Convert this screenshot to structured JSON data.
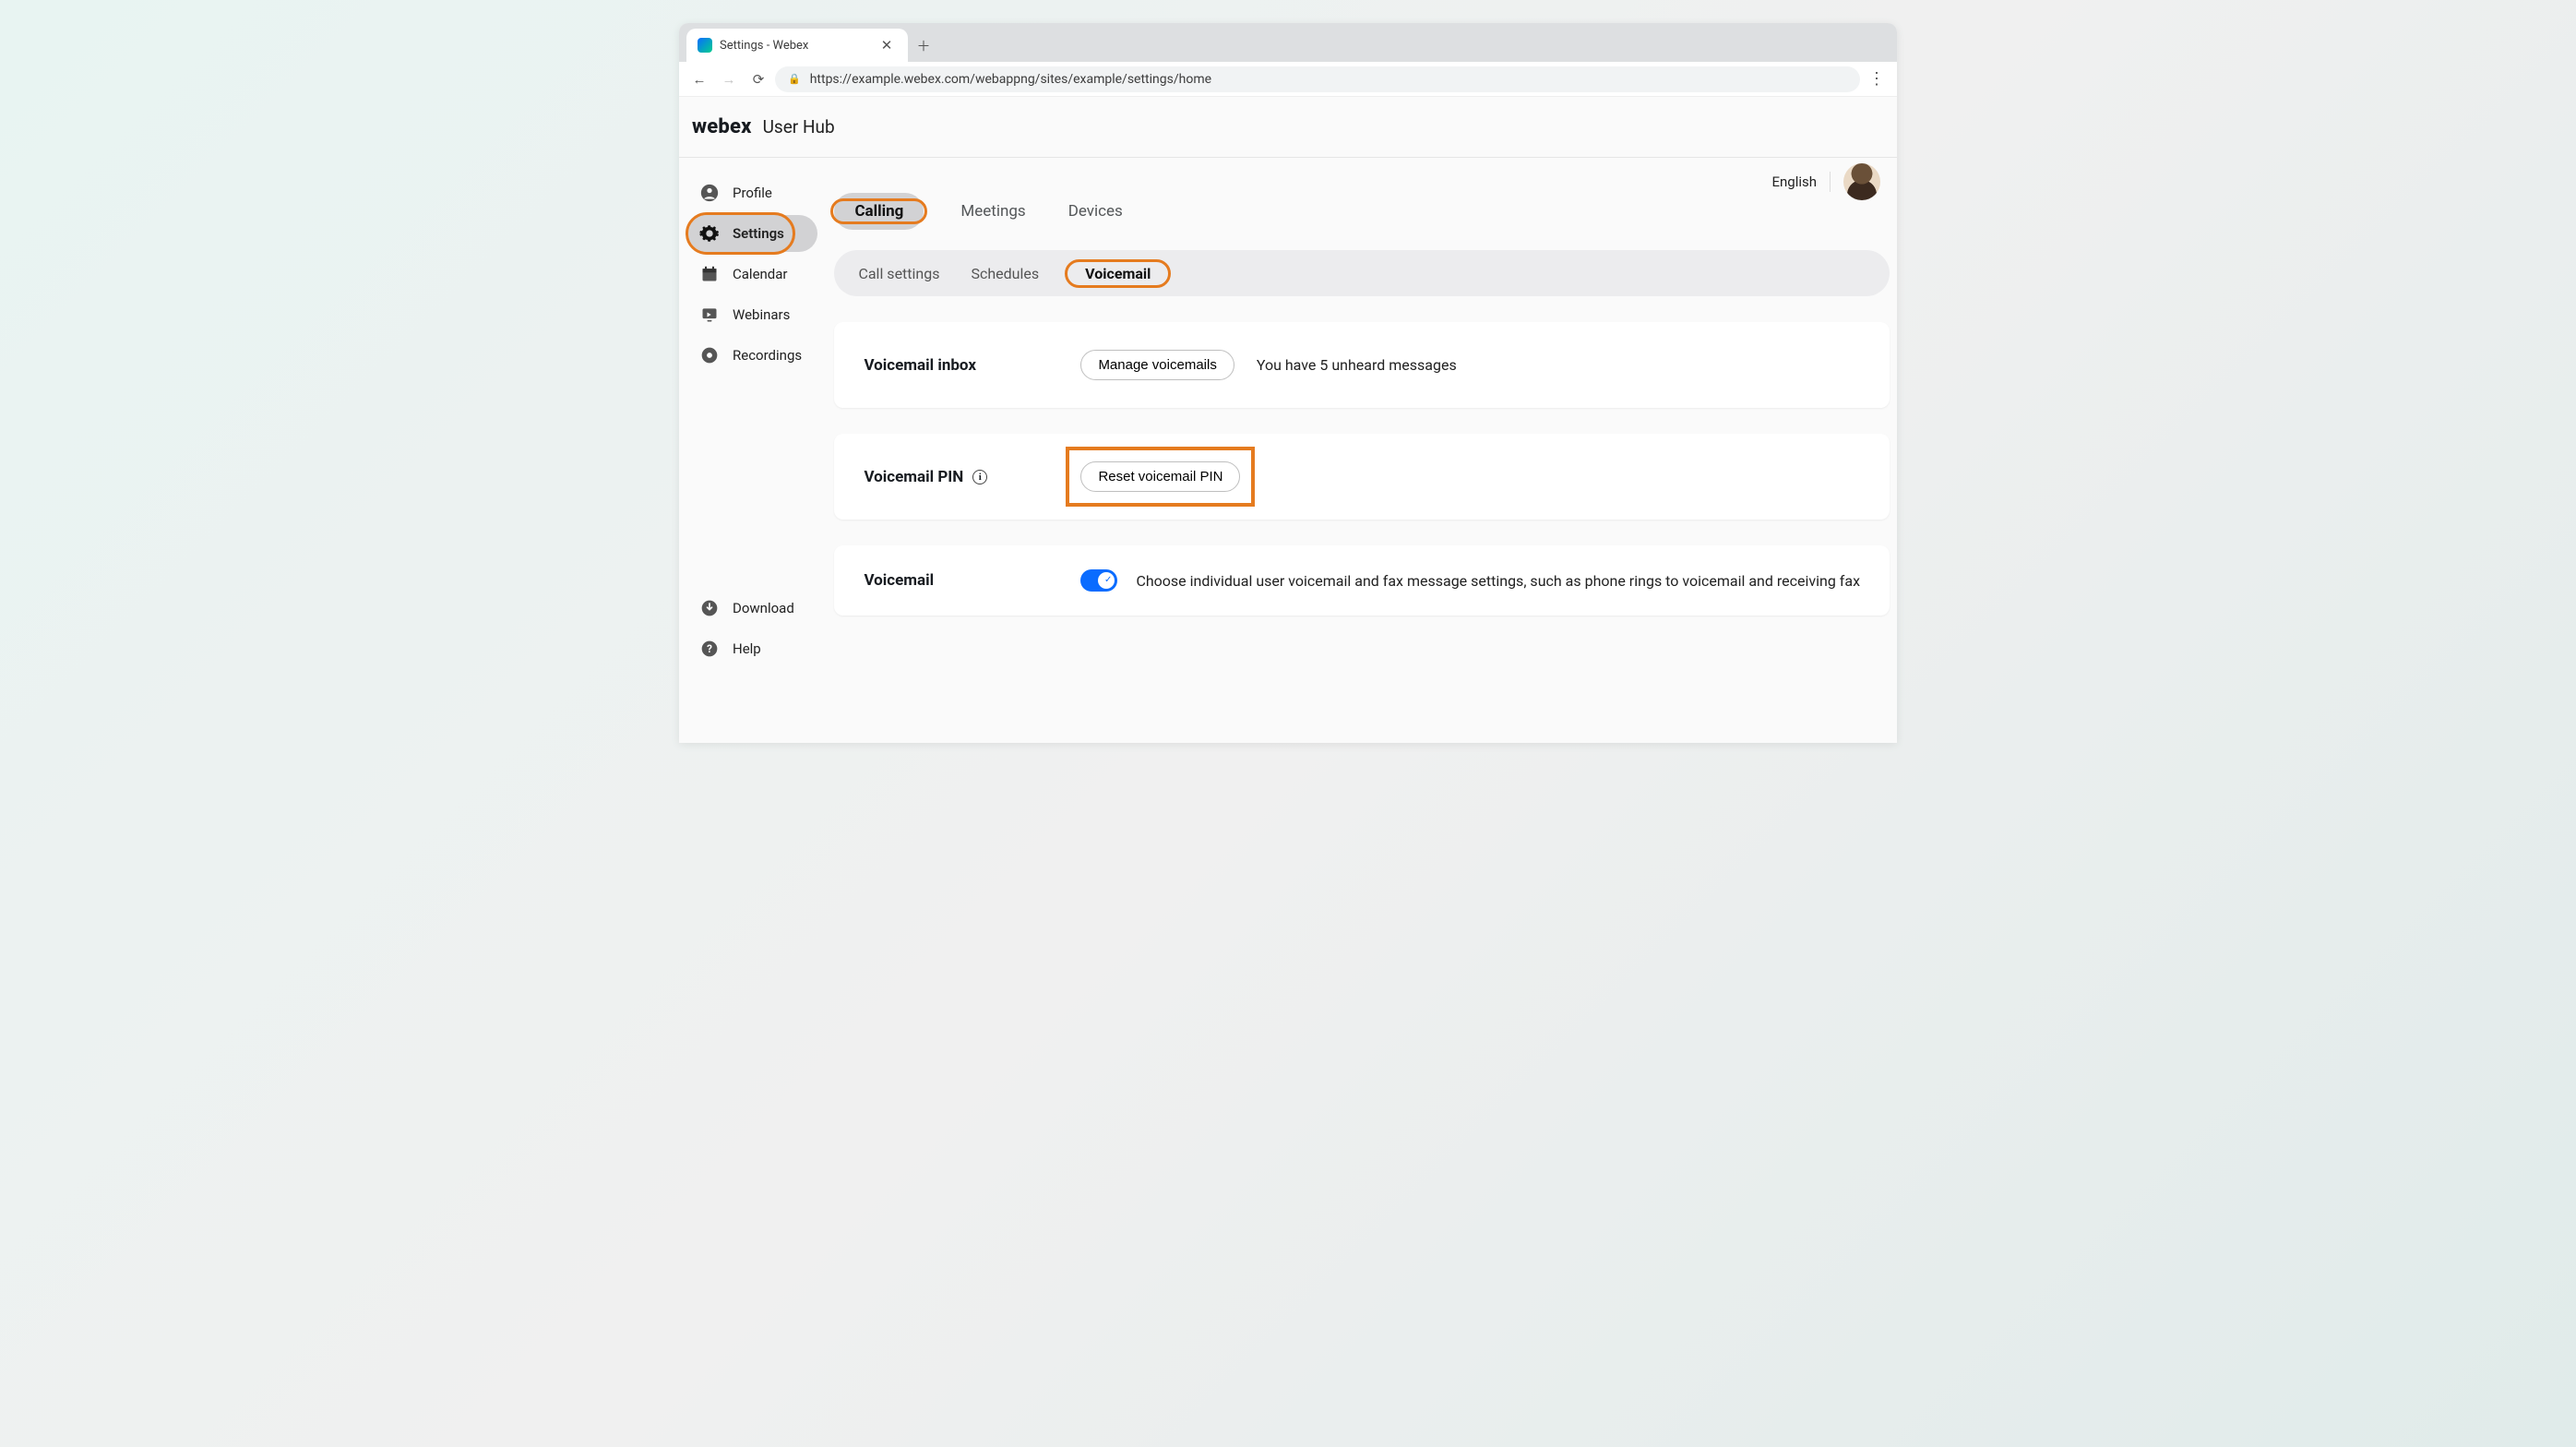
{
  "browser": {
    "tab_title": "Settings - Webex",
    "url": "https://example.webex.com/webappng/sites/example/settings/home"
  },
  "brand": {
    "logo": "webex",
    "subtitle": "User Hub"
  },
  "top": {
    "language": "English"
  },
  "sidebar": {
    "items": [
      {
        "label": "Profile"
      },
      {
        "label": "Settings"
      },
      {
        "label": "Calendar"
      },
      {
        "label": "Webinars"
      },
      {
        "label": "Recordings"
      }
    ],
    "bottom": [
      {
        "label": "Download"
      },
      {
        "label": "Help"
      }
    ]
  },
  "primary_tabs": {
    "items": [
      {
        "label": "Calling"
      },
      {
        "label": "Meetings"
      },
      {
        "label": "Devices"
      }
    ]
  },
  "sub_tabs": {
    "items": [
      {
        "label": "Call settings"
      },
      {
        "label": "Schedules"
      },
      {
        "label": "Voicemail"
      }
    ]
  },
  "cards": {
    "inbox": {
      "title": "Voicemail inbox",
      "button": "Manage voicemails",
      "status": "You have 5 unheard messages"
    },
    "pin": {
      "title": "Voicemail PIN",
      "button": "Reset voicemail PIN"
    },
    "vm": {
      "title": "Voicemail",
      "desc": "Choose individual user voicemail and fax message settings, such as phone rings to voicemail and receiving fax"
    }
  }
}
